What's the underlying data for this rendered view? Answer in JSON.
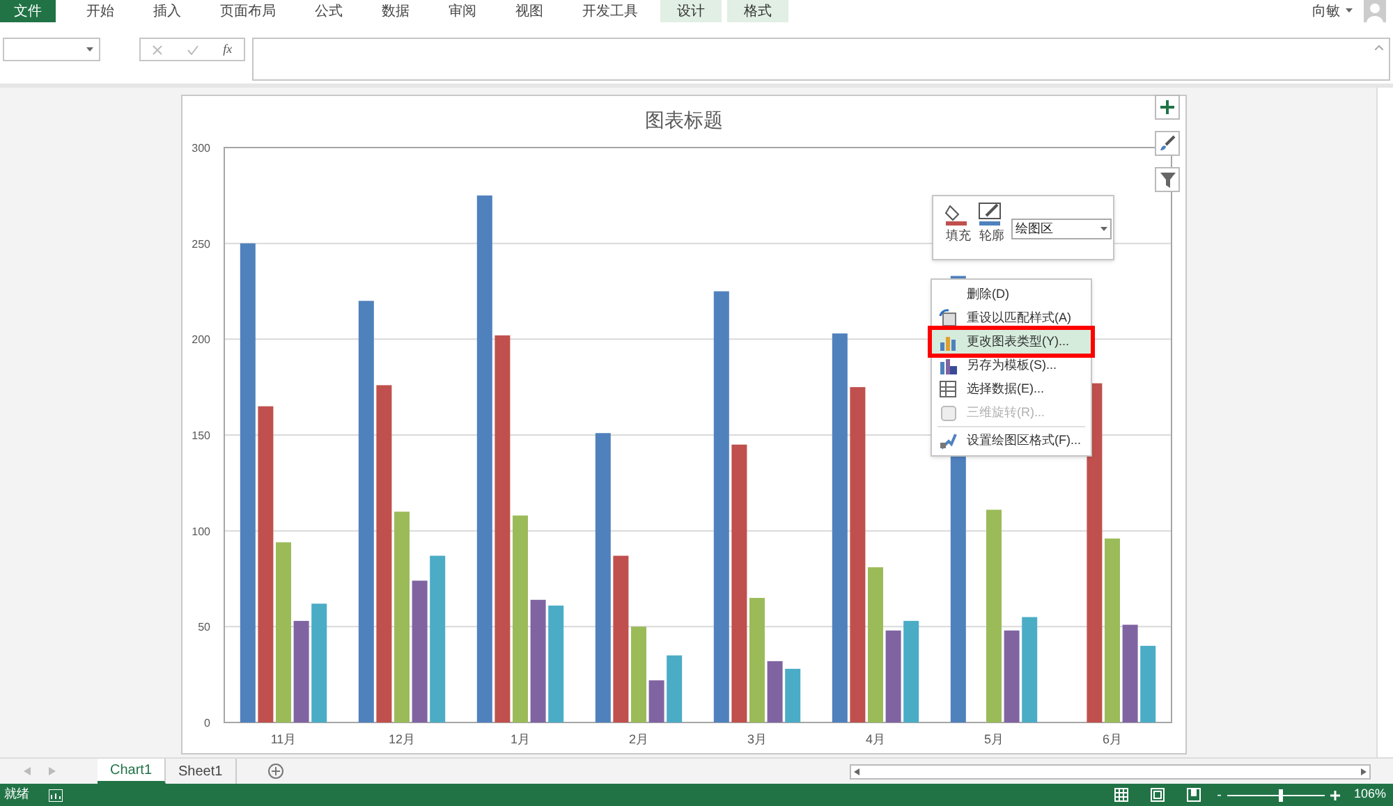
{
  "ribbon_tabs": [
    {
      "label": "文件",
      "kind": "file"
    },
    {
      "label": "开始",
      "kind": "normal"
    },
    {
      "label": "插入",
      "kind": "normal"
    },
    {
      "label": "页面布局",
      "kind": "normal"
    },
    {
      "label": "公式",
      "kind": "normal"
    },
    {
      "label": "数据",
      "kind": "normal"
    },
    {
      "label": "审阅",
      "kind": "normal"
    },
    {
      "label": "视图",
      "kind": "normal"
    },
    {
      "label": "开发工具",
      "kind": "normal"
    },
    {
      "label": "设计",
      "kind": "contextual"
    },
    {
      "label": "格式",
      "kind": "contextual"
    }
  ],
  "user": {
    "name": "向敏"
  },
  "formula_bar": {
    "fx": "fx"
  },
  "chart": {
    "chart_data": {
      "type": "bar",
      "title": "图表标题",
      "categories": [
        "11月",
        "12月",
        "1月",
        "2月",
        "3月",
        "4月",
        "5月",
        "6月"
      ],
      "ylim": [
        0,
        300
      ],
      "grid": true,
      "yticks": [
        0,
        50,
        100,
        150,
        200,
        250,
        300
      ],
      "series": [
        {
          "color": "#4f81bd",
          "values": [
            250,
            220,
            275,
            151,
            225,
            203,
            233,
            null
          ]
        },
        {
          "color": "#c0504d",
          "values": [
            165,
            176,
            202,
            87,
            145,
            175,
            null,
            177
          ]
        },
        {
          "color": "#9bbb59",
          "values": [
            94,
            110,
            108,
            50,
            65,
            81,
            111,
            96
          ]
        },
        {
          "color": "#8064a2",
          "values": [
            53,
            74,
            64,
            22,
            32,
            48,
            48,
            51
          ]
        },
        {
          "color": "#4bacc6",
          "values": [
            62,
            87,
            61,
            35,
            28,
            53,
            55,
            40
          ]
        }
      ]
    }
  },
  "mini_toolbar": {
    "fill": "填充",
    "outline": "轮廓",
    "element": "绘图区"
  },
  "context_menu": [
    {
      "label": "删除(D)",
      "selected": false,
      "disabled": false
    },
    {
      "label": "重设以匹配样式(A)",
      "selected": false,
      "disabled": false
    },
    {
      "label": "更改图表类型(Y)...",
      "selected": true,
      "disabled": false
    },
    {
      "label": "另存为模板(S)...",
      "selected": false,
      "disabled": false
    },
    {
      "label": "选择数据(E)...",
      "selected": false,
      "disabled": false
    },
    {
      "label": "三维旋转(R)...",
      "selected": false,
      "disabled": true
    },
    {
      "label": "设置绘图区格式(F)...",
      "selected": false,
      "disabled": false
    }
  ],
  "sheet_tabs": [
    {
      "label": "Chart1",
      "selected": true
    },
    {
      "label": "Sheet1",
      "selected": false
    }
  ],
  "status_bar": {
    "status": "就绪",
    "zoom": "106%",
    "zoom_out": "-",
    "zoom_slider": {
      "level": 0.55
    }
  }
}
